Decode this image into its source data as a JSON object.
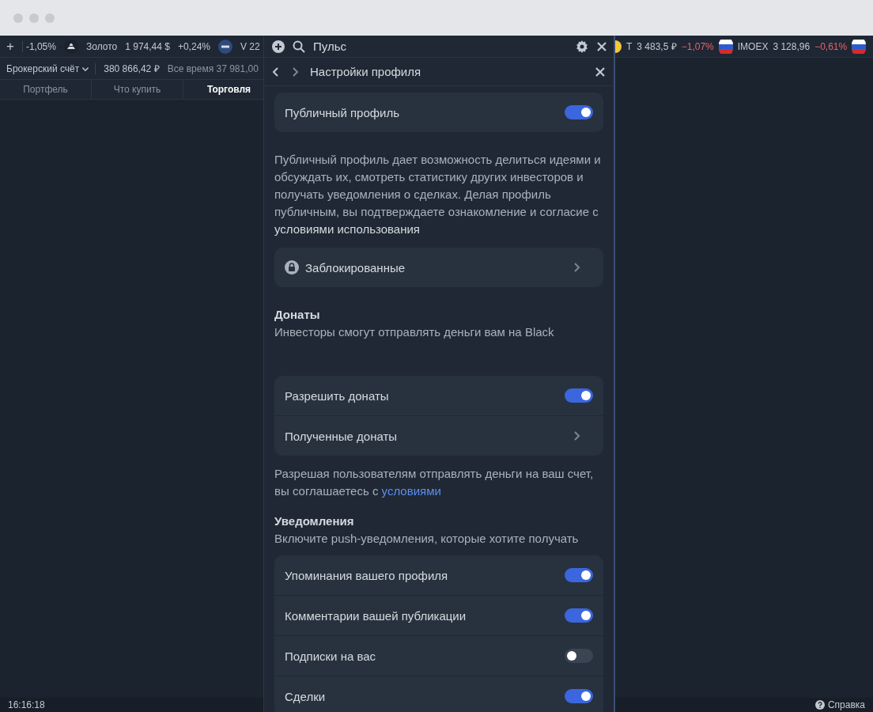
{
  "ticker_left": [
    {
      "kind": "plus",
      "text": "+"
    },
    {
      "kind": "change",
      "text": "-1,05%"
    },
    {
      "kind": "asset",
      "name": "Золото",
      "price": "1 974,44 $",
      "change": "+0,24%"
    },
    {
      "kind": "asset",
      "name": "V 22"
    }
  ],
  "ticker_right": [
    {
      "kind": "asset",
      "name": "Т",
      "price": "3 483,5 ₽",
      "change": "−1,07%",
      "color": "#e5646b"
    },
    {
      "kind": "asset",
      "name": "IMOEX",
      "price": "3 128,96",
      "change": "−0,61%",
      "color": "#e5646b"
    },
    {
      "kind": "asset"
    }
  ],
  "account": {
    "name": "Брокерский счёт",
    "balance": "380 866,42 ₽",
    "all_time": "Все время 37 981,00"
  },
  "tabs": [
    {
      "label": "Портфель",
      "selected": false
    },
    {
      "label": "Что купить",
      "selected": false
    },
    {
      "label": "Торговля",
      "selected": true
    }
  ],
  "panel": {
    "search": "Пульс",
    "title": "Настройки профиля",
    "sections": [
      {
        "kind": "card",
        "rows": [
          {
            "kind": "toggle",
            "label": "Публичный профиль",
            "on": true
          }
        ]
      },
      {
        "kind": "note",
        "text": "Публичный профиль дает возможность делиться идеями и обсуждать их, смотреть статистику других инвесторов и получать уведомления о сделках. Делая профиль публичным, вы подтверждаете ознакомление и согласие с **условиями использования**"
      },
      {
        "kind": "card",
        "rows": [
          {
            "kind": "link",
            "label": "Заблокированные"
          }
        ]
      },
      {
        "kind": "heading",
        "title": "Донаты",
        "text": "Инвесторы смогут отправлять деньги вам на Black"
      },
      {
        "kind": "card",
        "rows": [
          {
            "kind": "toggle",
            "label": "Разрешить донаты",
            "on": true
          },
          {
            "kind": "link",
            "label": "Полученные донаты"
          }
        ]
      },
      {
        "kind": "note",
        "text": "Разрешая пользователям отправлять деньги на ваш счет, вы соглашаетесь с ",
        "link": "условиями"
      },
      {
        "kind": "heading",
        "title": "Уведомления",
        "text": "Включите push-уведомления, которые хотите получать"
      },
      {
        "kind": "card",
        "rows": [
          {
            "kind": "toggle",
            "label": "Упоминания вашего профиля",
            "on": true
          },
          {
            "kind": "toggle",
            "label": "Комментарии вашей публикации",
            "on": true
          },
          {
            "kind": "toggle",
            "label": "Подписки на вас",
            "on": false
          },
          {
            "kind": "toggle",
            "label": "Сделки",
            "on": true
          }
        ]
      }
    ]
  },
  "status": {
    "time": "16:16:18",
    "help": "Справка"
  }
}
